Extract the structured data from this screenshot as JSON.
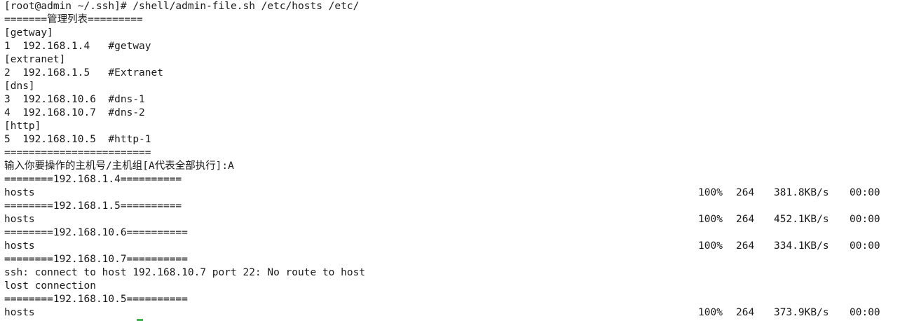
{
  "terminal": {
    "lines": [
      "[root@admin ~/.ssh]# /shell/admin-file.sh /etc/hosts /etc/",
      "=======管理列表=========",
      "[getway]",
      "1  192.168.1.4   #getway",
      "[extranet]",
      "2  192.168.1.5   #Extranet",
      "[dns]",
      "3  192.168.10.6  #dns-1",
      "4  192.168.10.7  #dns-2",
      "[http]",
      "5  192.168.10.5  #http-1",
      "========================",
      "输入你要操作的主机号/主机组[A代表全部执行]:A",
      "========192.168.1.4==========",
      "hosts",
      "========192.168.1.5==========",
      "hosts",
      "========192.168.10.6==========",
      "hosts",
      "========192.168.10.7==========",
      "ssh: connect to host 192.168.10.7 port 22: No route to host",
      "lost connection",
      "========192.168.10.5==========",
      "hosts"
    ],
    "transfers": [
      {
        "percent": "100%",
        "size": "264",
        "rate": "381.8KB/s",
        "time": "00:00"
      },
      {
        "percent": "100%",
        "size": "264",
        "rate": "452.1KB/s",
        "time": "00:00"
      },
      {
        "percent": "100%",
        "size": "264",
        "rate": "334.1KB/s",
        "time": "00:00"
      },
      {
        "percent": "100%",
        "size": "264",
        "rate": "373.9KB/s",
        "time": "00:00"
      }
    ],
    "cursor_color": "#3ab54a"
  }
}
